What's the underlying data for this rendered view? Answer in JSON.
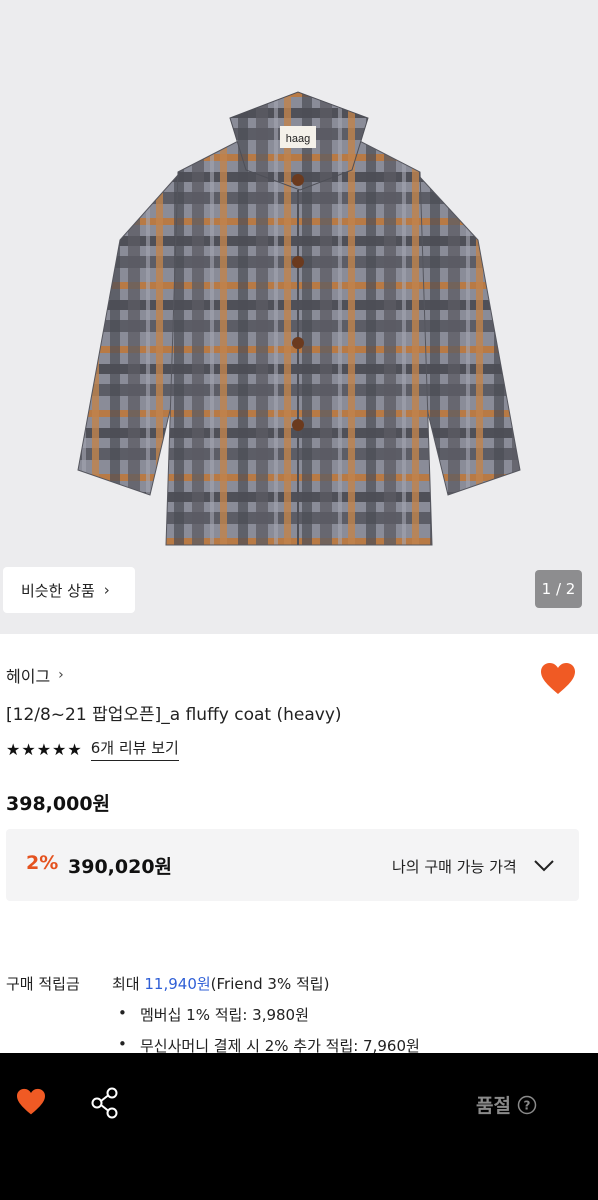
{
  "gallery": {
    "image_alt": "plaid fluffy coat",
    "label_tag": "haag",
    "similar_products_label": "비슷한 상품",
    "pager_text": "1 / 2"
  },
  "product": {
    "brand": "헤이그",
    "title": "[12/8~21 팝업오픈]_a fluffy coat (heavy)",
    "stars": "★★★★★",
    "review_link": "6개 리뷰 보기",
    "price": "398,000원",
    "liked": true
  },
  "discount": {
    "rate": "2%",
    "price": "390,020원",
    "my_price_label": "나의 구매 가능 가격"
  },
  "points": {
    "label": "구매 적립금",
    "max_prefix": "최대 ",
    "max_amount": "11,940원",
    "max_suffix": "(Friend 3% 적립)",
    "items": [
      "멤버십 1% 적립: 3,980원",
      "무신사머니 결제 시 2% 추가 적립: 7,960원"
    ]
  },
  "bottom_bar": {
    "status": "품절"
  },
  "colors": {
    "accent_orange": "#f05a24",
    "discount_red": "#e4521f",
    "link_blue": "#2f5fd6"
  }
}
